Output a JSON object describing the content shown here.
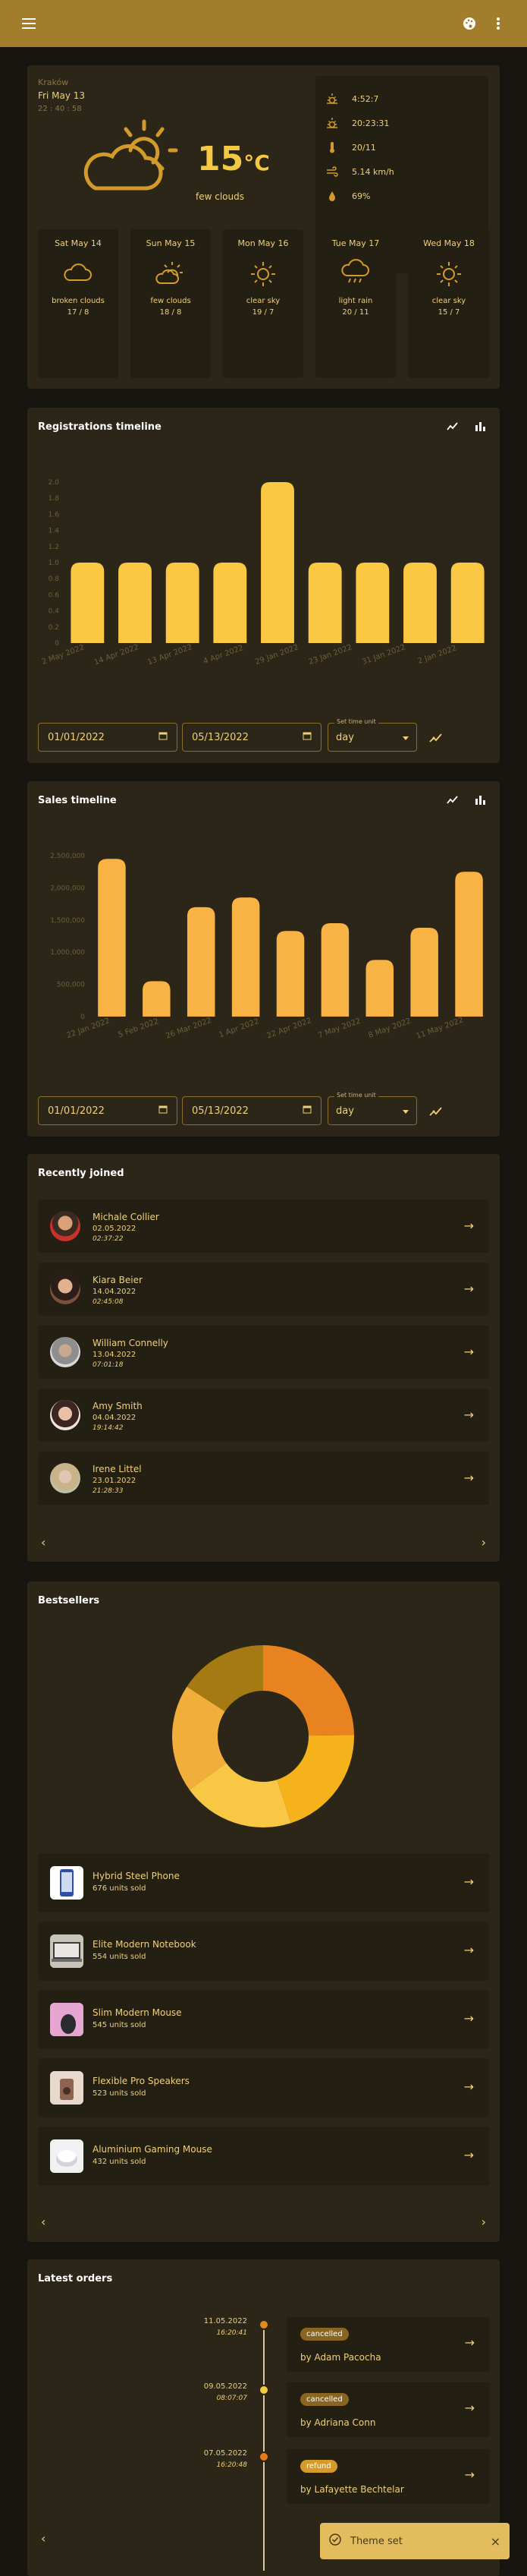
{
  "weather": {
    "city": "Kraków",
    "date": "Fri May 13",
    "time": "22 : 40 : 58",
    "temperature": "15",
    "unit": "°C",
    "description": "few clouds",
    "stats": [
      {
        "icon": "sunrise-icon",
        "value": "4:52:7"
      },
      {
        "icon": "sunset-icon",
        "value": "20:23:31"
      },
      {
        "icon": "thermometer-icon",
        "value": "20/11"
      },
      {
        "icon": "wind-icon",
        "value": "5.14 km/h"
      },
      {
        "icon": "humidity-icon",
        "value": "69%"
      }
    ],
    "forecast": [
      {
        "day": "Sat May 14",
        "icon": "cloud-icon",
        "desc": "broken clouds",
        "temp": "17 / 8"
      },
      {
        "day": "Sun May 15",
        "icon": "partly-cloudy-icon",
        "desc": "few clouds",
        "temp": "18 / 8"
      },
      {
        "day": "Mon May 16",
        "icon": "sun-icon",
        "desc": "clear sky",
        "temp": "19 / 7"
      },
      {
        "day": "Tue May 17",
        "icon": "rain-icon",
        "desc": "light rain",
        "temp": "20 / 11"
      },
      {
        "day": "Wed May 18",
        "icon": "sun-icon",
        "desc": "clear sky",
        "temp": "15 / 7"
      }
    ]
  },
  "registrations": {
    "title": "Registrations timeline",
    "from_date": "01/01/2022",
    "to_date": "05/13/2022",
    "time_unit_label": "Set time unit",
    "time_unit": "day"
  },
  "sales": {
    "title": "Sales timeline",
    "from_date": "01/01/2022",
    "to_date": "05/13/2022",
    "time_unit_label": "Set time unit",
    "time_unit": "day"
  },
  "recent": {
    "title": "Recently joined",
    "users": [
      {
        "name": "Michale Collier",
        "date": "02.05.2022",
        "time": "02:37:22"
      },
      {
        "name": "Kiara Beier",
        "date": "14.04.2022",
        "time": "02:45:08"
      },
      {
        "name": "William Connelly",
        "date": "13.04.2022",
        "time": "07:01:18"
      },
      {
        "name": "Amy Smith",
        "date": "04.04.2022",
        "time": "19:14:42"
      },
      {
        "name": "Irene Littel",
        "date": "23.01.2022",
        "time": "21:28:33"
      }
    ]
  },
  "bestsellers": {
    "title": "Bestsellers",
    "products": [
      {
        "name": "Hybrid Steel Phone",
        "sold": "676 units sold"
      },
      {
        "name": "Elite Modern Notebook",
        "sold": "554 units sold"
      },
      {
        "name": "Slim Modern Mouse",
        "sold": "545 units sold"
      },
      {
        "name": "Flexible Pro Speakers",
        "sold": "523 units sold"
      },
      {
        "name": "Aluminium Gaming Mouse",
        "sold": "432 units sold"
      }
    ]
  },
  "orders": {
    "title": "Latest orders",
    "items": [
      {
        "date": "11.05.2022",
        "time": "16:20:41",
        "status": "cancelled",
        "by": "by Adam Pacocha",
        "dot_color": "#e08a1e",
        "badge_color": "#8a6520"
      },
      {
        "date": "09.05.2022",
        "time": "08:07:07",
        "status": "cancelled",
        "by": "by Adriana Conn",
        "dot_color": "#f5c842",
        "badge_color": "#8a6520"
      },
      {
        "date": "07.05.2022",
        "time": "16:20:48",
        "status": "refund",
        "by": "by Lafayette Bechtelar",
        "dot_color": "#e87a1e",
        "badge_color": "#d59b2a"
      }
    ]
  },
  "toast": {
    "text": "Theme set"
  },
  "chart_data": [
    {
      "type": "bar",
      "categories": [
        "2 May 2022",
        "14 Apr 2022",
        "13 Apr 2022",
        "4 Apr 2022",
        "29 Jan 2022",
        "23 Jan 2022",
        "31 Jan 2022",
        "2 Jan 2022",
        ""
      ],
      "values": [
        1,
        1,
        1,
        1,
        2,
        1,
        1,
        1,
        1
      ],
      "ylim": [
        0,
        2
      ],
      "yticks": [
        "0",
        "0.2",
        "0.4",
        "0.6",
        "0.8",
        "1.0",
        "1.2",
        "1.4",
        "1.6",
        "1.8",
        "2.0"
      ]
    },
    {
      "type": "bar",
      "categories": [
        "22 Jan 2022",
        "5 Feb 2022",
        "26 Mar 2022",
        "",
        "1 Apr 2022",
        "22 Apr 2022",
        "7 May 2022",
        "8 May 2022",
        "11 May 2022",
        ""
      ],
      "values": [
        2450000,
        550000,
        1700000,
        1850000,
        1330000,
        1450000,
        880000,
        1380000,
        2250000
      ],
      "ylim": [
        0,
        2500000
      ],
      "yticks": [
        "0",
        "500,000",
        "1,000,000",
        "1,500,000",
        "2,000,000",
        "2,500,000"
      ]
    },
    {
      "type": "pie",
      "categories": [
        "Hybrid Steel Phone",
        "Elite Modern Notebook",
        "Slim Modern Mouse",
        "Flexible Pro Speakers",
        "Aluminium Gaming Mouse"
      ],
      "values": [
        676,
        554,
        545,
        523,
        432
      ],
      "colors": [
        "#e8831f",
        "#f6b21b",
        "#f8c844",
        "#f2ae3a",
        "#a67a13"
      ]
    }
  ]
}
